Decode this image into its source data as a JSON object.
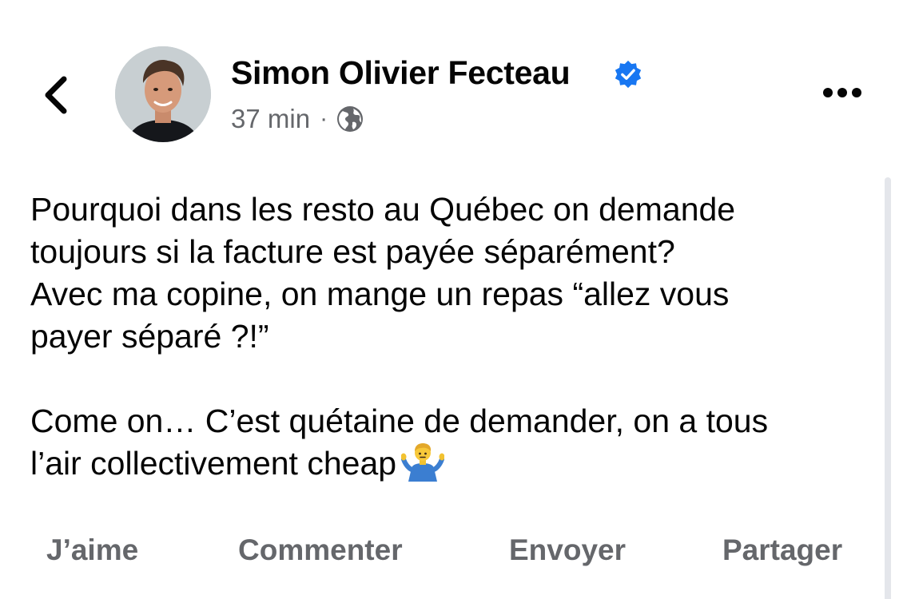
{
  "post": {
    "author": {
      "name": "Simon Olivier Fecteau",
      "verified": true
    },
    "timestamp": "37 min",
    "separator": "·",
    "audience_icon": "globe-icon",
    "text": {
      "line1": "Pourquoi dans les resto au Québec on demande",
      "line2": "toujours si la facture est payée séparément?",
      "line3": "Avec ma copine, on mange un repas “allez vous",
      "line4": "payer séparé ?!”",
      "line5": "Come on… C’est quétaine de demander, on a tous",
      "line6": "l’air collectivement cheap",
      "emoji": "man-shrugging-emoji"
    }
  },
  "actions": {
    "like": "J’aime",
    "comment": "Commenter",
    "send": "Envoyer",
    "share": "Partager"
  },
  "colors": {
    "verified_badge": "#1877f2",
    "secondary_text": "#65676b",
    "primary_text": "#050505"
  }
}
